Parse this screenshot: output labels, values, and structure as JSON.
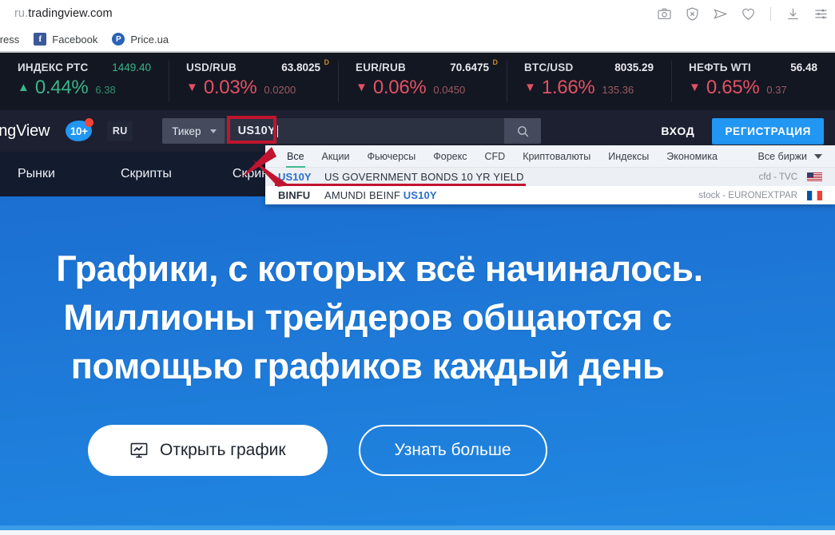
{
  "browser": {
    "url_scheme": "ru.",
    "url_host": "tradingview.com",
    "icons": [
      "camera-icon",
      "shield-block-icon",
      "send-icon",
      "heart-icon",
      "download-icon",
      "settings-sliders-icon"
    ],
    "bookmarks": [
      {
        "label": "xpress",
        "favicon": "none"
      },
      {
        "label": "Facebook",
        "favicon": "facebook-icon",
        "glyph": "f"
      },
      {
        "label": "Price.ua",
        "favicon": "price-ua-icon",
        "glyph": "P"
      }
    ]
  },
  "tickers": [
    {
      "name": "ИНДЕКС РТС",
      "price": "1449.40",
      "price_color": "green",
      "suffix": "",
      "direction": "up",
      "arrow": "▲",
      "percent": "0.44%",
      "change": "6.38"
    },
    {
      "name": "USD/RUB",
      "price": "63.8025",
      "price_color": "white",
      "suffix": "D",
      "direction": "down",
      "arrow": "▼",
      "percent": "0.03%",
      "change": "0.0200"
    },
    {
      "name": "EUR/RUB",
      "price": "70.6475",
      "price_color": "white",
      "suffix": "D",
      "direction": "down",
      "arrow": "▼",
      "percent": "0.06%",
      "change": "0.0450"
    },
    {
      "name": "BTC/USD",
      "price": "8035.29",
      "price_color": "white",
      "suffix": "",
      "direction": "down",
      "arrow": "▼",
      "percent": "1.66%",
      "change": "135.36"
    },
    {
      "name": "НЕФТЬ WTI",
      "price": "56.48",
      "price_color": "white",
      "suffix": "",
      "direction": "down",
      "arrow": "▼",
      "percent": "0.65%",
      "change": "0.37"
    }
  ],
  "nav": {
    "logo_text": "ingView",
    "badge_count": "10+",
    "lang_button": "RU",
    "ticker_dropdown_label": "Тикер",
    "search_value": "US10Y",
    "search_icon": "search-icon",
    "login_label": "ВХОД",
    "register_label": "РЕГИСТРАЦИЯ"
  },
  "subnav": {
    "items": [
      "Рынки",
      "Скрипты",
      "Скринер"
    ]
  },
  "dropdown": {
    "tabs": [
      {
        "label": "Все",
        "active": true
      },
      {
        "label": "Акции",
        "active": false
      },
      {
        "label": "Фьючерсы",
        "active": false
      },
      {
        "label": "Форекс",
        "active": false
      },
      {
        "label": "CFD",
        "active": false
      },
      {
        "label": "Криптовалюты",
        "active": false
      },
      {
        "label": "Индексы",
        "active": false
      },
      {
        "label": "Экономика",
        "active": false
      }
    ],
    "exchange_filter": "Все биржи",
    "results": [
      {
        "symbol": "US10Y",
        "symbol_style": "blue",
        "description_prefix": "US GOVERNMENT BONDS 10 YR YIELD",
        "description_highlight": "",
        "type": "cfd",
        "exchange": "TVC",
        "meta": "cfd - TVC",
        "flag": "us-flag",
        "highlighted": true
      },
      {
        "symbol": "BINFU",
        "symbol_style": "dark",
        "description_prefix": "AMUNDI BEINF ",
        "description_highlight": "US10Y",
        "type": "stock",
        "exchange": "EURONEXTPAR",
        "meta": "stock - EURONEXTPAR",
        "flag": "fr-flag",
        "highlighted": false
      }
    ]
  },
  "hero": {
    "headline_line1": "Графики, с которых всё начиналось.",
    "headline_line2": "Миллионы трейдеров общаются с",
    "headline_line3": "помощью графиков каждый день",
    "primary_cta": "Открыть график",
    "primary_cta_icon": "chart-monitor-icon",
    "secondary_cta": "Узнать больше"
  },
  "colors": {
    "accent_blue": "#2196f3",
    "hero_blue": "#1e7ad8",
    "ticker_bg": "#131722",
    "nav_bg": "#1c2030",
    "subnav_bg": "#131b2e",
    "up_green": "#3bb58a",
    "down_red": "#e35163",
    "annotation_red": "#c0142f",
    "tab_active_underline": "#3fba8f"
  }
}
